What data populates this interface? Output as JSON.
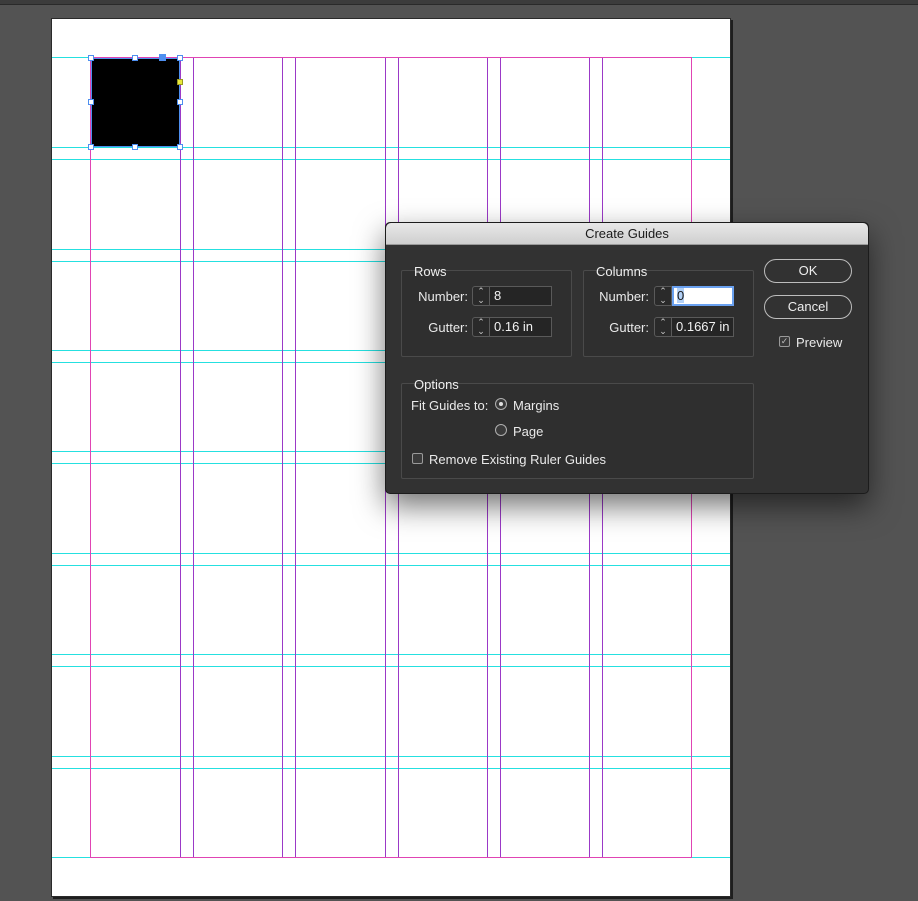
{
  "dialog": {
    "title": "Create Guides",
    "rows": {
      "title": "Rows",
      "number_label": "Number:",
      "number_value": "8",
      "gutter_label": "Gutter:",
      "gutter_value": "0.16 in"
    },
    "columns": {
      "title": "Columns",
      "number_label": "Number:",
      "number_value": "0",
      "gutter_label": "Gutter:",
      "gutter_value": "0.1667 in"
    },
    "buttons": {
      "ok": "OK",
      "cancel": "Cancel"
    },
    "preview": {
      "label": "Preview",
      "checked": true
    },
    "options": {
      "title": "Options",
      "fit_label": "Fit Guides to:",
      "fit_options": [
        "Margins",
        "Page"
      ],
      "selected": "Margins",
      "remove_existing_label": "Remove Existing Ruler Guides",
      "remove_existing_checked": false
    }
  },
  "colors": {
    "ruler_guide": "#25e0e0",
    "column_guide": "#9b39c7",
    "margin": "#e044b4",
    "selection": "#4e8ff0",
    "pasteboard": "#535353"
  }
}
